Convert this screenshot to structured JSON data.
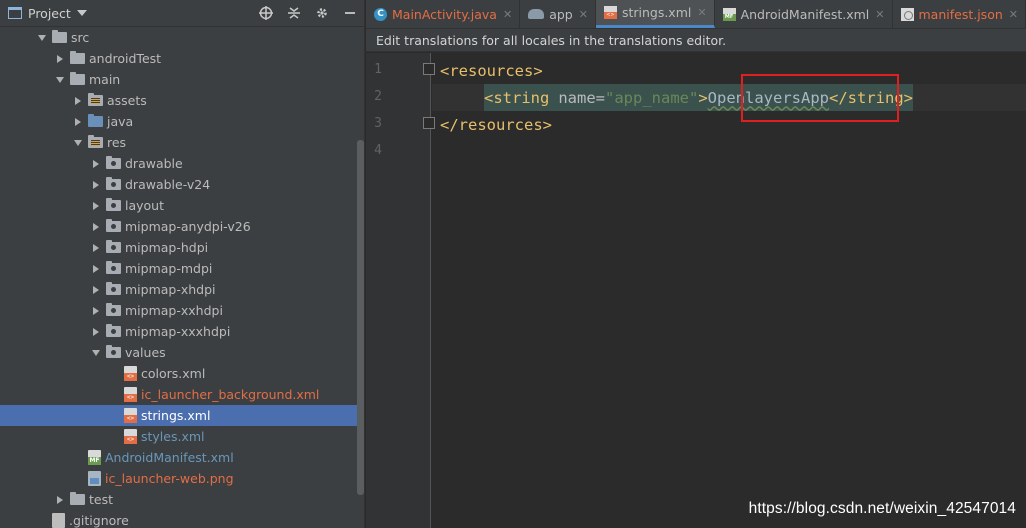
{
  "project_panel": {
    "title": "Project",
    "tree": [
      {
        "label": "src",
        "depth": 2,
        "arrow": "down",
        "icon": "folder"
      },
      {
        "label": "androidTest",
        "depth": 3,
        "arrow": "right",
        "icon": "folder"
      },
      {
        "label": "main",
        "depth": 3,
        "arrow": "down",
        "icon": "folder"
      },
      {
        "label": "assets",
        "depth": 4,
        "arrow": "right",
        "icon": "folder-res"
      },
      {
        "label": "java",
        "depth": 4,
        "arrow": "right",
        "icon": "folder-blue"
      },
      {
        "label": "res",
        "depth": 4,
        "arrow": "down",
        "icon": "folder-res"
      },
      {
        "label": "drawable",
        "depth": 5,
        "arrow": "right",
        "icon": "folder-dot"
      },
      {
        "label": "drawable-v24",
        "depth": 5,
        "arrow": "right",
        "icon": "folder-dot"
      },
      {
        "label": "layout",
        "depth": 5,
        "arrow": "right",
        "icon": "folder-dot"
      },
      {
        "label": "mipmap-anydpi-v26",
        "depth": 5,
        "arrow": "right",
        "icon": "folder-dot"
      },
      {
        "label": "mipmap-hdpi",
        "depth": 5,
        "arrow": "right",
        "icon": "folder-dot"
      },
      {
        "label": "mipmap-mdpi",
        "depth": 5,
        "arrow": "right",
        "icon": "folder-dot"
      },
      {
        "label": "mipmap-xhdpi",
        "depth": 5,
        "arrow": "right",
        "icon": "folder-dot"
      },
      {
        "label": "mipmap-xxhdpi",
        "depth": 5,
        "arrow": "right",
        "icon": "folder-dot"
      },
      {
        "label": "mipmap-xxxhdpi",
        "depth": 5,
        "arrow": "right",
        "icon": "folder-dot"
      },
      {
        "label": "values",
        "depth": 5,
        "arrow": "down",
        "icon": "folder-dot"
      },
      {
        "label": "colors.xml",
        "depth": 6,
        "arrow": "none",
        "icon": "xml",
        "color": "normal"
      },
      {
        "label": "ic_launcher_background.xml",
        "depth": 6,
        "arrow": "none",
        "icon": "xml",
        "color": "red"
      },
      {
        "label": "strings.xml",
        "depth": 6,
        "arrow": "none",
        "icon": "xml",
        "color": "normal",
        "selected": true
      },
      {
        "label": "styles.xml",
        "depth": 6,
        "arrow": "none",
        "icon": "xml",
        "color": "blue"
      },
      {
        "label": "AndroidManifest.xml",
        "depth": 4,
        "arrow": "none",
        "icon": "mf",
        "color": "blue"
      },
      {
        "label": "ic_launcher-web.png",
        "depth": 4,
        "arrow": "none",
        "icon": "png",
        "color": "red"
      },
      {
        "label": "test",
        "depth": 3,
        "arrow": "right",
        "icon": "folder"
      },
      {
        "label": ".gitignore",
        "depth": 2,
        "arrow": "none",
        "icon": "git"
      }
    ]
  },
  "tabs": [
    {
      "label": "MainActivity.java",
      "icon": "c",
      "color": "red",
      "active": false
    },
    {
      "label": "app",
      "icon": "app",
      "color": "normal",
      "active": false
    },
    {
      "label": "strings.xml",
      "icon": "xml",
      "color": "normal",
      "active": true
    },
    {
      "label": "AndroidManifest.xml",
      "icon": "mf",
      "color": "normal",
      "active": false
    },
    {
      "label": "manifest.json",
      "icon": "json",
      "color": "red",
      "active": false
    }
  ],
  "notice": "Edit translations for all locales in the translations editor.",
  "line_numbers": [
    "1",
    "2",
    "3",
    "4"
  ],
  "code": {
    "line1_open": "<resources>",
    "line2_tag_open": "<string",
    "line2_attr": "name=",
    "line2_value": "\"app_name\"",
    "line2_gt": ">",
    "line2_text": "OpenlayersApp",
    "line2_close": "</string>",
    "line3_close": "</resources>"
  },
  "watermark": "https://blog.csdn.net/weixin_42547014"
}
